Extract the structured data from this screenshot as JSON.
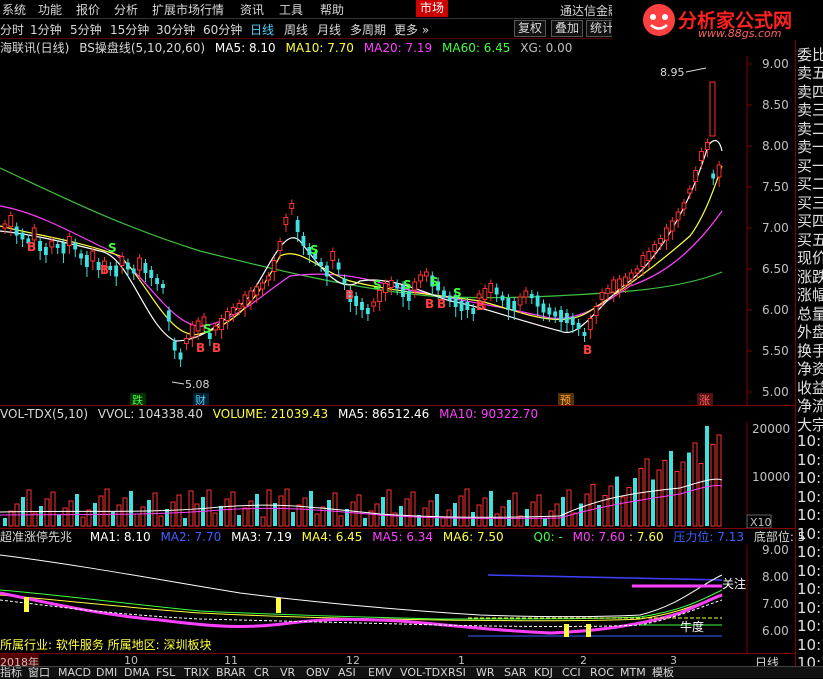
{
  "menu": {
    "items": [
      "系统",
      "功能",
      "报价",
      "分析",
      "扩展市场行情",
      "资讯",
      "工具",
      "帮助"
    ],
    "active": "市场",
    "broker": "通达信金融"
  },
  "logo": {
    "text": "分析家公式网",
    "url": "www.88gs.com"
  },
  "periods": [
    "分时",
    "1分钟",
    "5分钟",
    "15分钟",
    "30分钟",
    "60分钟",
    "日线",
    "周线",
    "月线",
    "多周期",
    "更多"
  ],
  "active_period": "日线",
  "toolbar": {
    "reinstate": "复权",
    "overlay": "叠加",
    "stats": "统计"
  },
  "main_panel": {
    "stock": "海联讯(日线)",
    "indicator": "BS操盘线(5,10,20,60)",
    "ma5": "MA5: 8.10",
    "ma10": "MA10: 7.70",
    "ma20": "MA20: 7.19",
    "ma60": "MA60: 6.45",
    "xg": "XG: 0.00",
    "high_label": "8.95",
    "low_label": "5.08",
    "price_ticks": [
      "9.00",
      "8.50",
      "8.00",
      "7.50",
      "7.00",
      "6.50",
      "6.00",
      "5.50",
      "5.00"
    ],
    "events": [
      {
        "label": "跌",
        "color": "#40ff40"
      },
      {
        "label": "财",
        "color": "#4fd0ff"
      },
      {
        "label": "预",
        "color": "#ffa040"
      },
      {
        "label": "涨",
        "color": "#ff6060"
      }
    ],
    "signals_b": [
      "B",
      "B",
      "B",
      "B",
      "B",
      "B",
      "B",
      "B",
      "B"
    ],
    "signals_s": [
      "S",
      "S",
      "S",
      "S",
      "S",
      "S",
      "S"
    ]
  },
  "volume_panel": {
    "name": "VOL-TDX(5,10)",
    "vvol": "VVOL: 104338.40",
    "volume": "VOLUME: 21039.43",
    "ma5": "MA5: 86512.46",
    "ma10": "MA10: 90322.70",
    "ticks": [
      "20000",
      "10000"
    ],
    "unit": "X10"
  },
  "indicator_panel": {
    "name": "超准涨停先兆",
    "ma1": "MA1: 8.10",
    "ma2": "MA2: 7.70",
    "ma3": "MA3: 7.19",
    "ma4": "MA4: 6.45",
    "ma5": "MA5: 6.34",
    "ma6": "MA6: 7.50",
    "q0": "Q0: -",
    "m0": "M0: 7.60",
    "m0b": ": 7.60",
    "pressure": "压力位: 7.13",
    "bottom": "底部位: 5",
    "ticks": [
      "9.00",
      "8.00",
      "7.00",
      "6.00"
    ],
    "attention": "关注",
    "cow": "牛度",
    "sector_text": "所属行业: 软件服务 所属地区: 深圳板块"
  },
  "x_axis": {
    "labels": [
      "2018年",
      "10",
      "11",
      "12",
      "1",
      "2",
      "3"
    ],
    "right": "日线"
  },
  "right_panel": [
    "卖五",
    "卖四",
    "卖三",
    "卖二",
    "卖一",
    "买一",
    "买二",
    "买三",
    "买四",
    "买五",
    "现价",
    "涨跌",
    "涨幅",
    "总量",
    "外盘",
    "换手",
    "净资",
    "收益",
    "净流",
    "大宗",
    "10:1",
    "10:1",
    "10:1",
    "10:1",
    "10:1",
    "10:1",
    "10:1",
    "10:1",
    "10:1",
    "10:1",
    "10:1",
    "10:1",
    "10:1"
  ],
  "right_panel_top": "委比",
  "bottom_tabs": [
    "指标",
    "窗口",
    "MACD",
    "DMI",
    "DMA",
    "FSL",
    "TRIX",
    "BRAR",
    "CR",
    "VR",
    "OBV",
    "ASI",
    "EMV",
    "VOL-TDX",
    "RSI",
    "WR",
    "SAR",
    "KDJ",
    "CCI",
    "ROC",
    "MTM",
    "模板"
  ]
}
